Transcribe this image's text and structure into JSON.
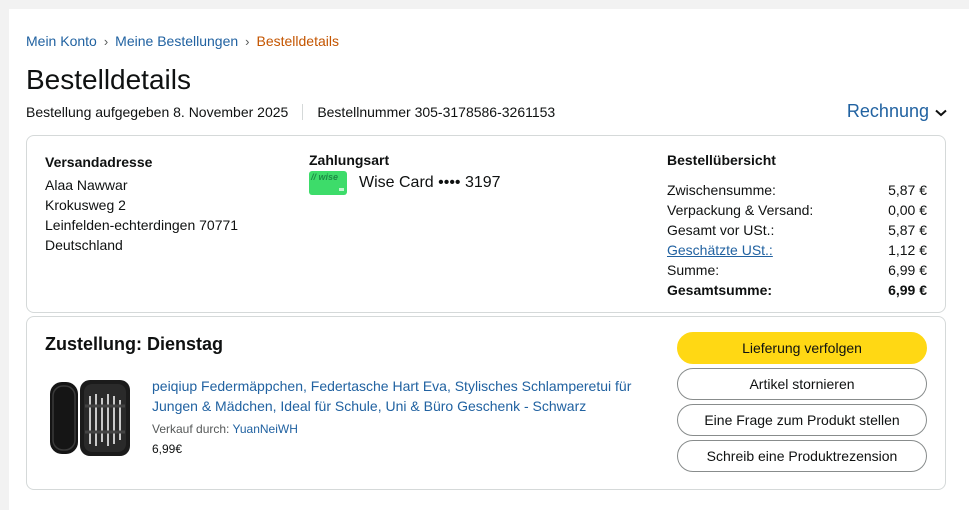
{
  "breadcrumb": {
    "account": "Mein Konto",
    "orders": "Meine Bestellungen",
    "current": "Bestelldetails",
    "sep": "›"
  },
  "page_title": "Bestelldetails",
  "order": {
    "placed": "Bestellung aufgegeben 8. November 2025",
    "number": "Bestellnummer 305-3178586-3261153"
  },
  "invoice": {
    "label": "Rechnung",
    "chevron": "⌄"
  },
  "shipping": {
    "header": "Versandadresse",
    "lines": [
      "Alaa Nawwar",
      "Krokusweg 2",
      "Leinfelden-echterdingen 70771",
      "Deutschland"
    ]
  },
  "payment": {
    "header": "Zahlungsart",
    "card_mark": "// wise",
    "card_text": "Wise Card •••• 3197"
  },
  "summary": {
    "header": "Bestellübersicht",
    "rows": [
      {
        "label": "Zwischensumme:",
        "value": "5,87 €"
      },
      {
        "label": "Verpackung & Versand:",
        "value": "0,00 €"
      },
      {
        "label": "Gesamt vor USt.:",
        "value": "5,87 €"
      },
      {
        "label": "Geschätzte USt.:",
        "value": "1,12 €"
      },
      {
        "label": "Summe:",
        "value": "6,99 €"
      },
      {
        "label": "Gesamtsumme:",
        "value": "6,99 €"
      }
    ]
  },
  "delivery": {
    "header": "Zustellung: Dienstag",
    "product": {
      "title": "peiqiup Federmäppchen, Federtasche Hart Eva, Stylisches Schlamperetui für Jungen & Mädchen, Ideal für Schule, Uni & Büro Geschenk - Schwarz",
      "sold_by_label": "Verkauf durch:",
      "seller": "YuanNeiWH",
      "price": "6,99€"
    },
    "buttons": {
      "track": "Lieferung verfolgen",
      "cancel": "Artikel stornieren",
      "question": "Eine Frage zum Produkt stellen",
      "review": "Schreib eine Produktrezension"
    }
  },
  "colors": {
    "link": "#2162a1",
    "breadcrumb_current": "#c45500",
    "primary_button": "#ffd814",
    "card": "#3ddc6a"
  }
}
